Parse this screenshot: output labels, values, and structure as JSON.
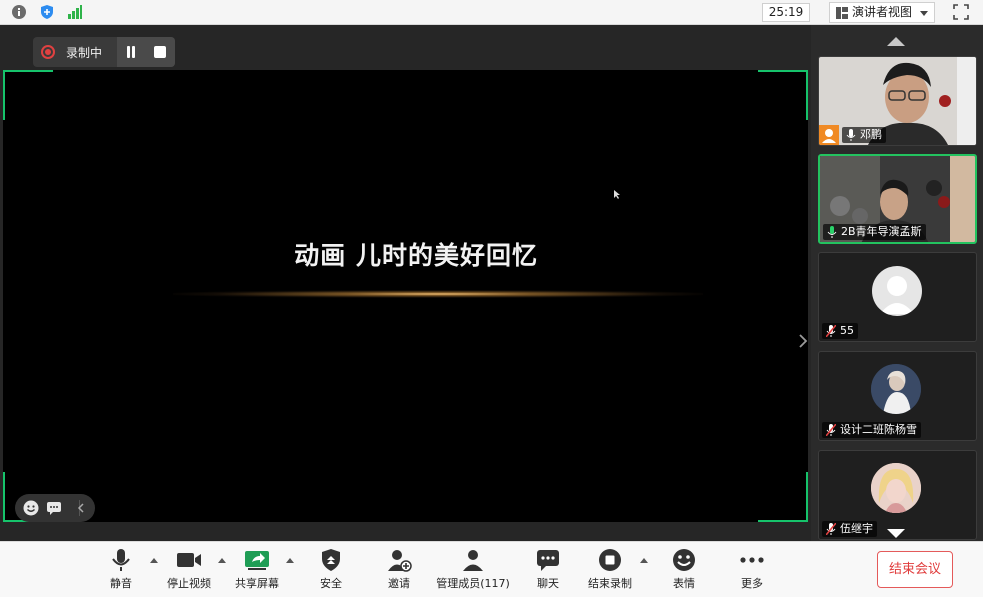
{
  "topbar": {
    "info_icon": "info-icon",
    "shield_icon": "shield-icon",
    "signal_icon": "signal-icon",
    "timer": "25:19",
    "view_label": "演讲者视图",
    "fullscreen_icon": "fullscreen-icon"
  },
  "recording": {
    "status": "录制中"
  },
  "slide": {
    "title": "动画  儿时的美好回忆"
  },
  "participants": [
    {
      "name": "邓鹏",
      "mic": "on",
      "active": false
    },
    {
      "name": "2B青年导演孟斯",
      "mic": "on",
      "active": true
    },
    {
      "name": "55",
      "mic": "muted",
      "active": false
    },
    {
      "name": "设计二班陈杨雪",
      "mic": "muted",
      "active": false
    },
    {
      "name": "伍继宇",
      "mic": "muted",
      "active": false
    }
  ],
  "toolbar": {
    "mute": "静音",
    "stop_video": "停止视频",
    "share_screen": "共享屏幕",
    "security": "安全",
    "invite": "邀请",
    "manage_members": "管理成员(117)",
    "chat": "聊天",
    "end_recording": "结束录制",
    "reactions": "表情",
    "more": "更多",
    "end_meeting": "结束会议"
  },
  "colors": {
    "accent_green": "#16c36b",
    "record_red": "#e04141",
    "end_red": "#e03b3b"
  }
}
